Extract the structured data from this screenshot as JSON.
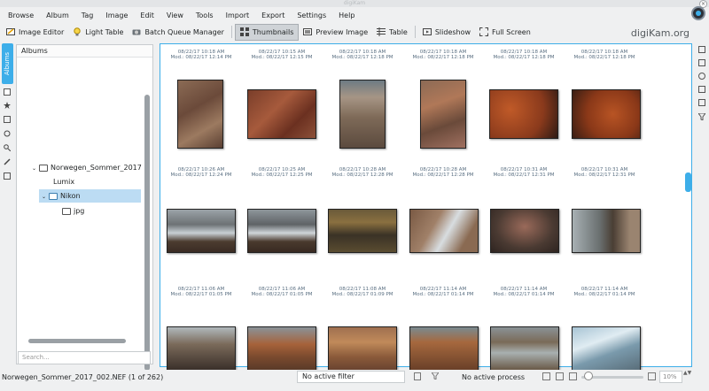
{
  "window": {
    "title": "digiKam",
    "close_glyph": "×"
  },
  "menu": [
    "Browse",
    "Album",
    "Tag",
    "Image",
    "Edit",
    "View",
    "Tools",
    "Import",
    "Export",
    "Settings",
    "Help"
  ],
  "toolbar": {
    "image_editor": "Image Editor",
    "light_table": "Light Table",
    "batch_queue": "Batch Queue Manager",
    "thumbnails": "Thumbnails",
    "preview": "Preview Image",
    "table": "Table",
    "slideshow": "Slideshow",
    "fullscreen": "Full Screen",
    "brand": "digiKam.org"
  },
  "sidebar": {
    "tab_label": "Albums",
    "panel_title": "Albums",
    "tree": [
      {
        "label": "Norwegen_Sommer_2017"
      },
      {
        "label": "Lumix"
      },
      {
        "label": "Nikon"
      },
      {
        "label": "jpg"
      }
    ],
    "search_placeholder": "Search..."
  },
  "grid": {
    "rows": [
      {
        "items": [
          {
            "line1": "08/22/17 10:18 AM",
            "line2": "Mod.: 08/22/17 12:14 PM"
          },
          {
            "line1": "08/22/17 10:15 AM",
            "line2": "Mod.: 08/22/17 12:15 PM"
          },
          {
            "line1": "08/22/17 10:18 AM",
            "line2": "Mod.: 08/22/17 12:18 PM"
          },
          {
            "line1": "08/22/17 10:18 AM",
            "line2": "Mod.: 08/22/17 12:18 PM"
          },
          {
            "line1": "08/22/17 10:18 AM",
            "line2": "Mod.: 08/22/17 12:18 PM"
          },
          {
            "line1": "08/22/17 10:18 AM",
            "line2": "Mod.: 08/22/17 12:18 PM"
          }
        ]
      },
      {
        "items": [
          {
            "line1": "08/22/17 10:26 AM",
            "line2": "Mod.: 08/22/17 12:24 PM"
          },
          {
            "line1": "08/22/17 10:25 AM",
            "line2": "Mod.: 08/22/17 12:25 PM"
          },
          {
            "line1": "08/22/17 10:28 AM",
            "line2": "Mod.: 08/22/17 12:28 PM"
          },
          {
            "line1": "08/22/17 10:28 AM",
            "line2": "Mod.: 08/22/17 12:28 PM"
          },
          {
            "line1": "08/22/17 10:31 AM",
            "line2": "Mod.: 08/22/17 12:31 PM"
          },
          {
            "line1": "08/22/17 10:31 AM",
            "line2": "Mod.: 08/22/17 12:31 PM"
          }
        ]
      },
      {
        "items": [
          {
            "line1": "08/22/17 11:06 AM",
            "line2": "Mod.: 08/22/17 01:05 PM"
          },
          {
            "line1": "08/22/17 11:06 AM",
            "line2": "Mod.: 08/22/17 01:05 PM"
          },
          {
            "line1": "08/22/17 11:08 AM",
            "line2": "Mod.: 08/22/17 01:09 PM"
          },
          {
            "line1": "08/22/17 11:14 AM",
            "line2": "Mod.: 08/22/17 01:14 PM"
          },
          {
            "line1": "08/22/17 11:14 AM",
            "line2": "Mod.: 08/22/17 01:14 PM"
          },
          {
            "line1": "08/22/17 11:14 AM",
            "line2": "Mod.: 08/22/17 01:14 PM"
          }
        ]
      }
    ]
  },
  "status": {
    "filename": "Norwegen_Sommer_2017_002.NEF (1 of 262)",
    "filter": "No active filter",
    "process": "No active process",
    "zoom": "10%",
    "zoom_arrows": "▲▼"
  },
  "colors": {
    "accent": "#3daee9",
    "selection": "#bcdcf3"
  }
}
